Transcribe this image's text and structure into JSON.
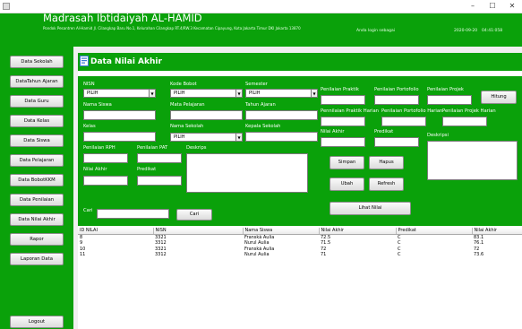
{
  "window": {
    "minimize": "–",
    "maximize": "☐",
    "close": "✕"
  },
  "header": {
    "title": "Madrasah Ibtidaiyah AL-HAMID",
    "subtitle": "Pondok Pesantren Al-Hamid Jl. Cilangkap Baru No.1, Kelurahan Cilangkap RT.4/RW.3 Kecamatan Cipayung, Kota Jakarta Timur DKI Jakarta 13870",
    "login_text": "Anda login sebagai",
    "date": "2020-09-20",
    "time": "04:41:058"
  },
  "sidebar": {
    "items": [
      {
        "label": "Data Sekolah"
      },
      {
        "label": "DataTahun Ajaran"
      },
      {
        "label": "Data Guru"
      },
      {
        "label": "Data Kelas"
      },
      {
        "label": "Data Siswa"
      },
      {
        "label": "Data Pelajaran"
      },
      {
        "label": "Data BobotKKM"
      },
      {
        "label": "Data Penilaian"
      },
      {
        "label": "Data Nilai Akhir"
      },
      {
        "label": "Rapor"
      },
      {
        "label": "Laporan Data"
      }
    ],
    "logout": "Logout"
  },
  "page": {
    "title": "Data Nilai Akhir"
  },
  "form": {
    "nisn_label": "NISN",
    "nisn_value": "PILIH",
    "kode_bobot_label": "Kode Bobot",
    "kode_bobot_value": "PILIH",
    "semester_label": "Semester",
    "semester_value": "PILIH",
    "nama_siswa_label": "Nama Siswa",
    "mata_pelajaran_label": "Mata Pelajaran",
    "tahun_ajaran_label": "Tahun Ajaran",
    "kelas_label": "Kelas",
    "nama_sekolah_label": "Nama Sekolah",
    "nama_sekolah_value": "PILIH",
    "kepala_sekolah_label": "Kepala Sekolah",
    "penilaian_rph_label": "Penilaian RPH",
    "penilaian_pat_label": "Penilaian PAT",
    "deskripsi_left_label": "Deskrips",
    "nilai_akhir_left_label": "Nilai Akhir",
    "predikat_left_label": "Predikat",
    "penilaian_praktik_label": "Penilaian Praktik",
    "penilaian_portofolio_label": "Penilaian Portofolio",
    "penilaian_projek_label": "Penilaian Projek",
    "hitung_label": "Hitung",
    "penilaian_praktik_harian_label": "Pennilaian Praktik Harian",
    "penilaian_portofolio_harian_label": "Penilaian Portofolio Harian",
    "penilaian_projek_harian_label": "Penilaian Projek Harian",
    "nilai_akhir_right_label": "Nilai Akhir",
    "predikat_right_label": "Predikat",
    "deskripsi_right_label": "Deskripsi",
    "simpan_label": "Simpan",
    "hapus_label": "Hapus",
    "ubah_label": "Ubah",
    "refresh_label": "Refresh",
    "lihat_nilai_label": "Lihat Nilai",
    "cari_label": "Cari",
    "cari_button": "Cari"
  },
  "table": {
    "columns": [
      "ID NILAI",
      "NISN",
      "Nama Siswa",
      "Nilai Akhir",
      "Predikat",
      "Nilai Akhir"
    ],
    "rows": [
      [
        "8",
        "3321",
        "Franská Aulia",
        "72.5",
        "C",
        "83.1"
      ],
      [
        "9",
        "3312",
        "Nurul Aulia",
        "71.5",
        "C",
        "76.1"
      ],
      [
        "10",
        "3321",
        "Franská Aulia",
        "72",
        "C",
        "72"
      ],
      [
        "11",
        "3312",
        "Nurul Aulia",
        "71",
        "C",
        "73.6"
      ]
    ]
  },
  "colors": {
    "accent": "#0aa10a",
    "panel": "#ffffff"
  }
}
